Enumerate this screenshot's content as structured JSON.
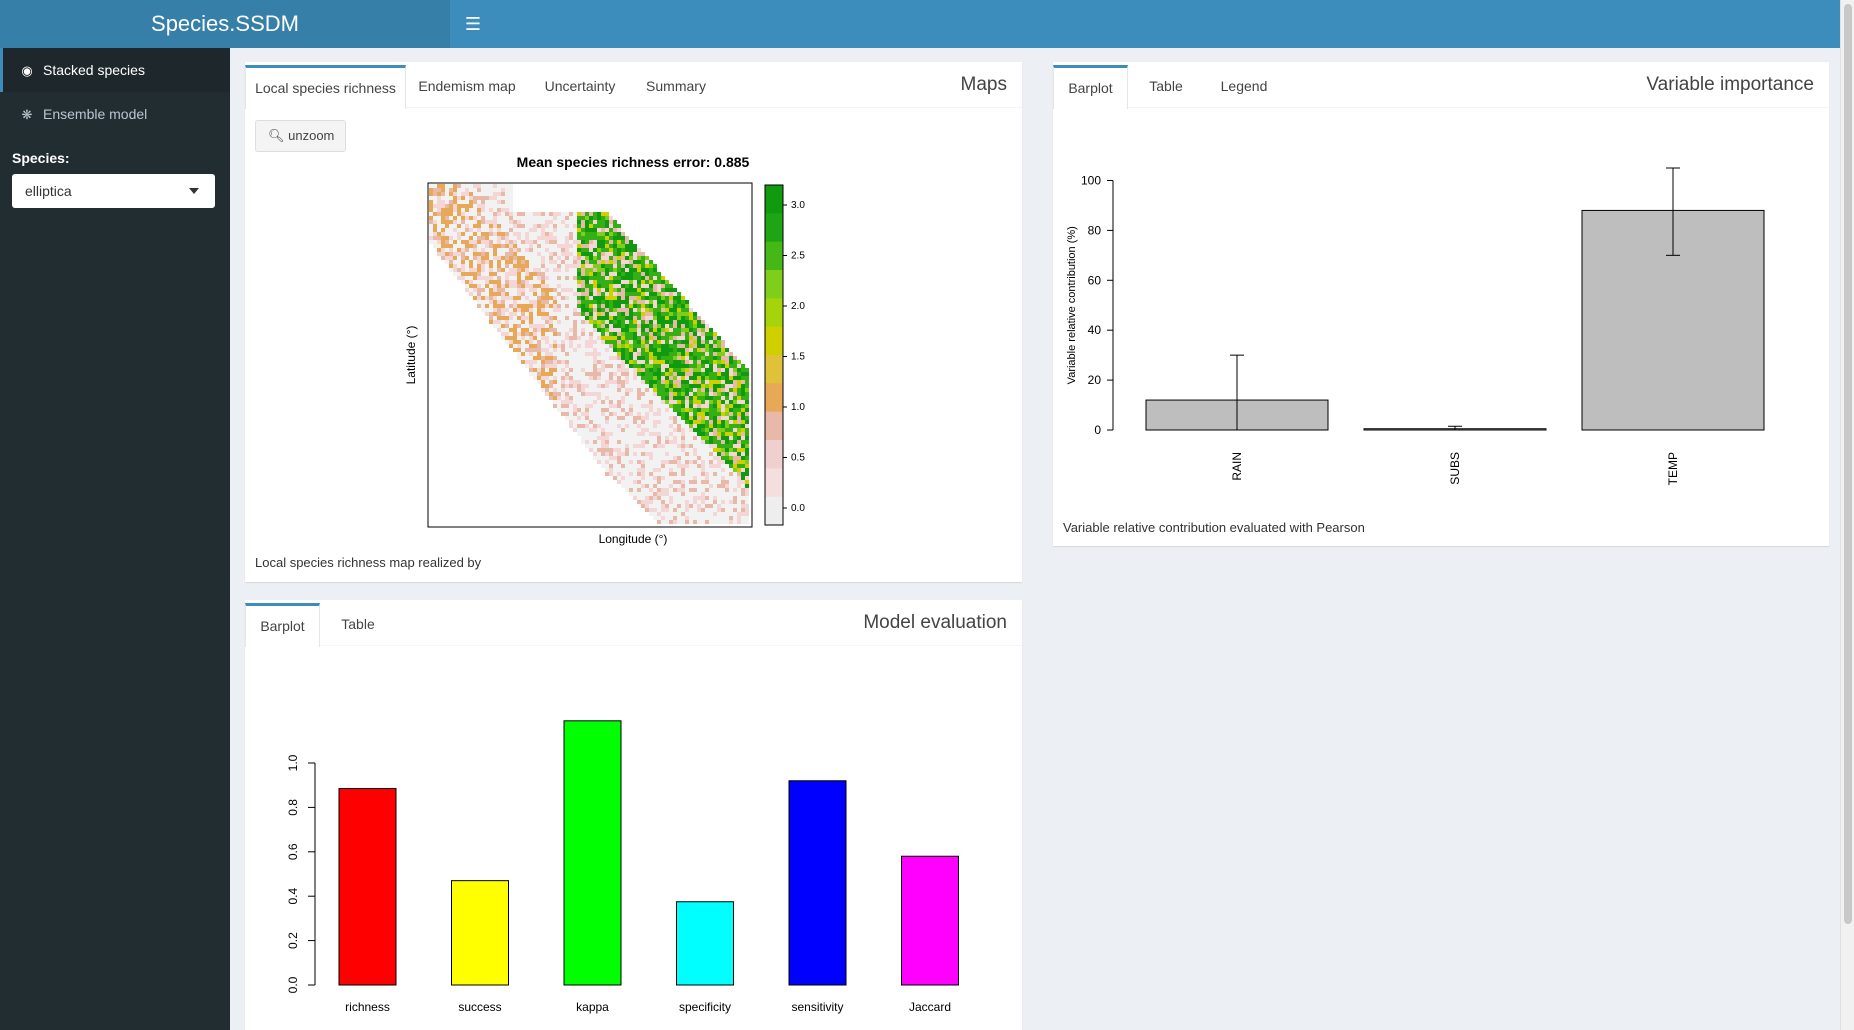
{
  "app": {
    "title": "Species.SSDM"
  },
  "sidebar": {
    "items": [
      {
        "label": "Stacked species",
        "icon": "dashboard-icon"
      },
      {
        "label": "Ensemble model",
        "icon": "tree-icon"
      }
    ],
    "species_label": "Species:",
    "species_value": "elliptica"
  },
  "maps": {
    "title": "Maps",
    "tabs": [
      "Local species richness",
      "Endemism map",
      "Uncertainty",
      "Summary"
    ],
    "unzoom_label": "unzoom",
    "plot_title": "Mean species richness error: 0.885",
    "xlabel": "Longitude (°)",
    "ylabel": "Latitude (°)",
    "legend_ticks": [
      "3.0",
      "2.5",
      "2.0",
      "1.5",
      "1.0",
      "0.5",
      "0.0"
    ],
    "caption": "Local species richness map realized by"
  },
  "variable_importance": {
    "title": "Variable importance",
    "tabs": [
      "Barplot",
      "Table",
      "Legend"
    ],
    "caption": "Variable relative contribution evaluated with Pearson"
  },
  "model_evaluation": {
    "title": "Model evaluation",
    "tabs": [
      "Barplot",
      "Table"
    ]
  },
  "chart_data": [
    {
      "type": "bar",
      "chart": "variable_importance",
      "categories": [
        "RAIN",
        "SUBS",
        "TEMP"
      ],
      "values": [
        12,
        0.5,
        88
      ],
      "error_low": [
        0,
        0,
        70
      ],
      "error_high": [
        30,
        1.5,
        105
      ],
      "ylabel": "Variable relative contribution (%)",
      "yticks": [
        0,
        20,
        40,
        60,
        80,
        100
      ],
      "ylim": [
        0,
        105
      ],
      "bar_color": "#bebebe"
    },
    {
      "type": "bar",
      "chart": "model_evaluation",
      "categories": [
        "richness",
        "success",
        "kappa",
        "specificity",
        "sensitivity",
        "Jaccard"
      ],
      "values": [
        0.885,
        0.47,
        1.19,
        0.375,
        0.92,
        0.58
      ],
      "colors": [
        "#ff0000",
        "#ffff00",
        "#00ff00",
        "#00ffff",
        "#0000ff",
        "#ff00ff"
      ],
      "yticks": [
        "0.0",
        "0.2",
        "0.4",
        "0.6",
        "0.8",
        "1.0"
      ],
      "ylim": [
        0,
        1.2
      ]
    }
  ]
}
